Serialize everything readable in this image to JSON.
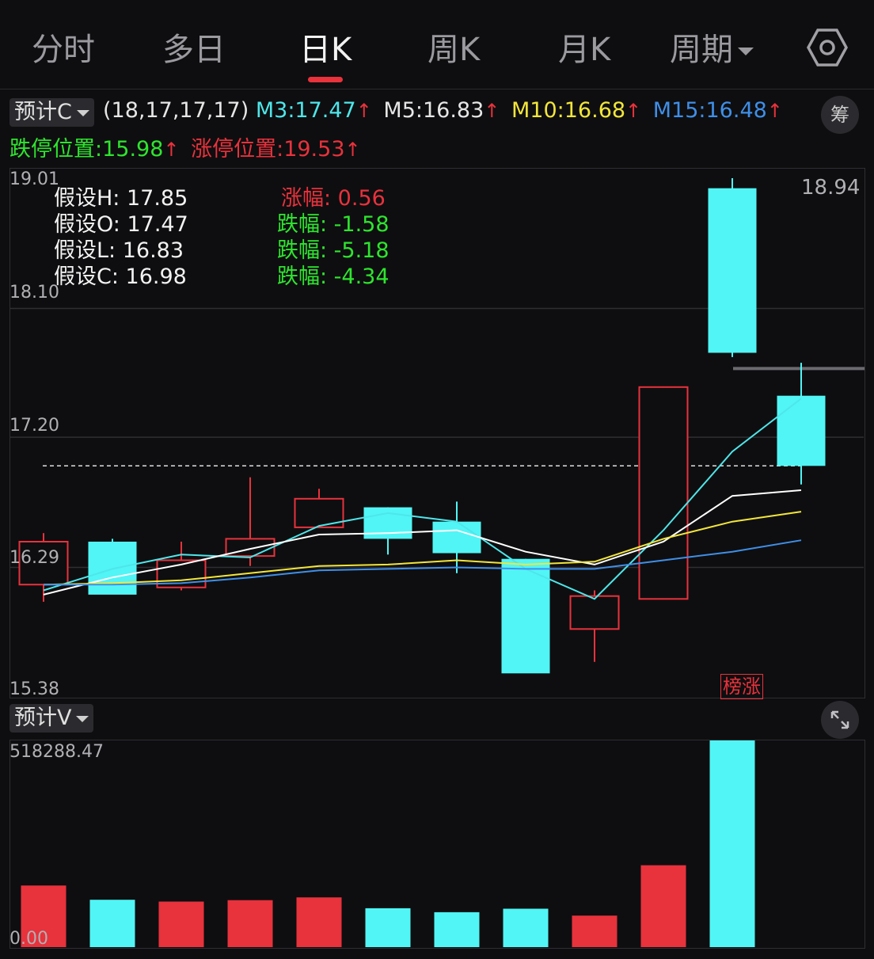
{
  "tabs": [
    {
      "label": "分时"
    },
    {
      "label": "多日"
    },
    {
      "label": "日K"
    },
    {
      "label": "周K"
    },
    {
      "label": "月K"
    },
    {
      "label": "周期"
    }
  ],
  "indicator": {
    "dropdown": "预计C",
    "params": "(18,17,17,17)",
    "m3": "M3:17.47",
    "m5": "M5:16.83",
    "m10": "M10:16.68",
    "m15": "M15:16.48",
    "arrow": "↑",
    "limit_down": "跌停位置:15.98",
    "limit_up": "涨停位置:19.53",
    "chip_btn": "筹"
  },
  "hypothesis": {
    "h": "假设H: 17.85",
    "o": "假设O: 17.47",
    "l": "假设L: 16.83",
    "c": "假设C: 16.98",
    "h_change": "涨幅: 0.56",
    "o_change": "跌幅: -1.58",
    "l_change": "跌幅: -5.18",
    "c_change": "跌幅: -4.34"
  },
  "price_axis": {
    "max": "19.01",
    "l2": "18.10",
    "l3": "17.20",
    "l4": "16.29",
    "min": "15.38"
  },
  "high_label": "18.94",
  "badge": "榜涨",
  "volume_panel": {
    "dropdown": "预计V",
    "max_label": "518288.47",
    "min_label": "0.00"
  },
  "colors": {
    "up": "#e8323c",
    "down": "#51f5f5",
    "m3": "#4ee6ea",
    "m5": "#ffffff",
    "m10": "#f2e63a",
    "m15": "#3f8fe8",
    "limit_down": "#2ee52e"
  },
  "chart_data": {
    "type": "candlestick",
    "ylim": [
      15.38,
      19.01
    ],
    "reference_line": 17.0,
    "candles": [
      {
        "open": 16.17,
        "high": 16.53,
        "low": 16.05,
        "close": 16.47
      },
      {
        "open": 16.47,
        "high": 16.49,
        "low": 16.13,
        "close": 16.1
      },
      {
        "open": 16.15,
        "high": 16.47,
        "low": 16.13,
        "close": 16.34
      },
      {
        "open": 16.37,
        "high": 16.92,
        "low": 16.3,
        "close": 16.49
      },
      {
        "open": 16.57,
        "high": 16.84,
        "low": 16.57,
        "close": 16.77
      },
      {
        "open": 16.71,
        "high": 16.71,
        "low": 16.38,
        "close": 16.49
      },
      {
        "open": 16.61,
        "high": 16.75,
        "low": 16.25,
        "close": 16.39
      },
      {
        "open": 16.35,
        "high": 16.35,
        "low": 15.61,
        "close": 15.55
      },
      {
        "open": 15.86,
        "high": 16.13,
        "low": 15.63,
        "close": 16.09
      },
      {
        "open": 16.07,
        "high": 17.55,
        "low": 16.07,
        "close": 17.55
      },
      {
        "open": 18.94,
        "high": 19.01,
        "low": 17.76,
        "close": 17.79
      },
      {
        "open": 17.49,
        "high": 17.72,
        "low": 16.87,
        "close": 17.0
      }
    ],
    "series": [
      {
        "name": "M3",
        "values": [
          16.13,
          16.28,
          16.38,
          16.36,
          16.58,
          16.67,
          16.61,
          16.28,
          16.07,
          16.55,
          17.1,
          17.47
        ]
      },
      {
        "name": "M5",
        "values": [
          16.1,
          16.22,
          16.31,
          16.42,
          16.52,
          16.53,
          16.55,
          16.4,
          16.31,
          16.47,
          16.79,
          16.83
        ]
      },
      {
        "name": "M10",
        "values": [
          16.17,
          16.18,
          16.2,
          16.25,
          16.3,
          16.31,
          16.34,
          16.31,
          16.33,
          16.49,
          16.61,
          16.68
        ]
      },
      {
        "name": "M15",
        "values": [
          16.17,
          16.17,
          16.18,
          16.22,
          16.27,
          16.28,
          16.29,
          16.28,
          16.28,
          16.34,
          16.4,
          16.48
        ]
      }
    ],
    "volume": [
      {
        "value": 154500,
        "dir": "up"
      },
      {
        "value": 118700,
        "dir": "down"
      },
      {
        "value": 114100,
        "dir": "up"
      },
      {
        "value": 117800,
        "dir": "up"
      },
      {
        "value": 124800,
        "dir": "up"
      },
      {
        "value": 97500,
        "dir": "down"
      },
      {
        "value": 87500,
        "dir": "down"
      },
      {
        "value": 96400,
        "dir": "down"
      },
      {
        "value": 79000,
        "dir": "up"
      },
      {
        "value": 205400,
        "dir": "up"
      },
      {
        "value": 518288.47,
        "dir": "down"
      },
      {
        "value": 0,
        "dir": "down"
      }
    ],
    "volume_ylim": [
      0,
      518288.47
    ]
  }
}
